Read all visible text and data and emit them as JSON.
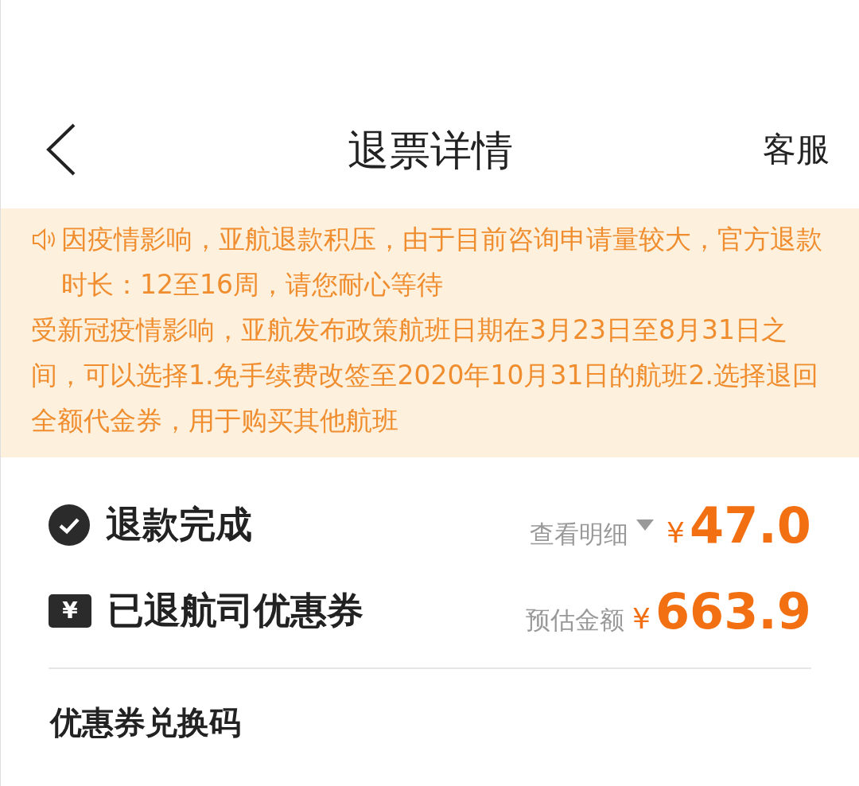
{
  "header": {
    "title": "退票详情",
    "action": "客服"
  },
  "notice": {
    "paragraphs": [
      "因疫情影响，亚航退款积压，由于目前咨询申请量较大，官方退款时长：12至16周，请您耐心等待",
      "受新冠疫情影响，亚航发布政策航班日期在3月23日至8月31日之间，可以选择1.免手续费改签至2020年10月31日的航班2.选择退回全额代金券，用于购买其他航班"
    ]
  },
  "rows": [
    {
      "kind": "refund",
      "label": "退款完成",
      "hint": "查看明细",
      "dropdown": true,
      "currency": "¥",
      "amount": "47.0"
    },
    {
      "kind": "coupon",
      "label": "已退航司优惠券",
      "icon_glyph": "¥",
      "hint": "预估金额",
      "currency": "¥",
      "amount": "663.9"
    }
  ],
  "section_title": "优惠券兑换码"
}
